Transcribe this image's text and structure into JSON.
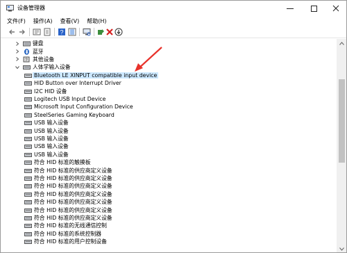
{
  "window": {
    "title": "设备管理器"
  },
  "menu": [
    {
      "label": "文件(F)"
    },
    {
      "label": "操作(A)"
    },
    {
      "label": "查看(V)"
    },
    {
      "label": "帮助(H)"
    }
  ],
  "toolbar": {
    "icons": [
      "back-icon",
      "forward-icon",
      "device-tree-icon",
      "properties-icon",
      "help-icon",
      "device-list-icon",
      "scan-hardware-icon",
      "update-driver-icon",
      "uninstall-icon",
      "disable-icon"
    ]
  },
  "tree": {
    "top_items": [
      {
        "label": "键盘",
        "icon": "keyboard-icon"
      },
      {
        "label": "蓝牙",
        "icon": "bluetooth-icon"
      },
      {
        "label": "其他设备",
        "icon": "other-devices-icon"
      },
      {
        "label": "人体学输入设备",
        "icon": "hid-category-icon"
      }
    ],
    "hid_children": [
      {
        "label": "Bluetooth LE XINPUT compatible input device",
        "selected": true
      },
      {
        "label": "HID Button over Interrupt Driver"
      },
      {
        "label": "I2C HID 设备"
      },
      {
        "label": "Logitech USB Input Device"
      },
      {
        "label": "Microsoft Input Configuration Device"
      },
      {
        "label": "SteelSeries Gaming Keyboard"
      },
      {
        "label": "USB 输入设备"
      },
      {
        "label": "USB 输入设备"
      },
      {
        "label": "USB 输入设备"
      },
      {
        "label": "USB 输入设备"
      },
      {
        "label": "USB 输入设备"
      },
      {
        "label": "符合 HID 标准的触摸板"
      },
      {
        "label": "符合 HID 标准的供应商定义设备"
      },
      {
        "label": "符合 HID 标准的供应商定义设备"
      },
      {
        "label": "符合 HID 标准的供应商定义设备"
      },
      {
        "label": "符合 HID 标准的供应商定义设备"
      },
      {
        "label": "符合 HID 标准的供应商定义设备"
      },
      {
        "label": "符合 HID 标准的供应商定义设备"
      },
      {
        "label": "符合 HID 标准的供应商定义设备"
      },
      {
        "label": "符合 HID 标准的无线通信控制"
      },
      {
        "label": "符合 HID 标准的系统控制器"
      },
      {
        "label": "符合 HID 标准的用户控制设备"
      }
    ]
  },
  "colors": {
    "selection": "#cce8ff",
    "annotation_arrow": "#e8322b"
  }
}
